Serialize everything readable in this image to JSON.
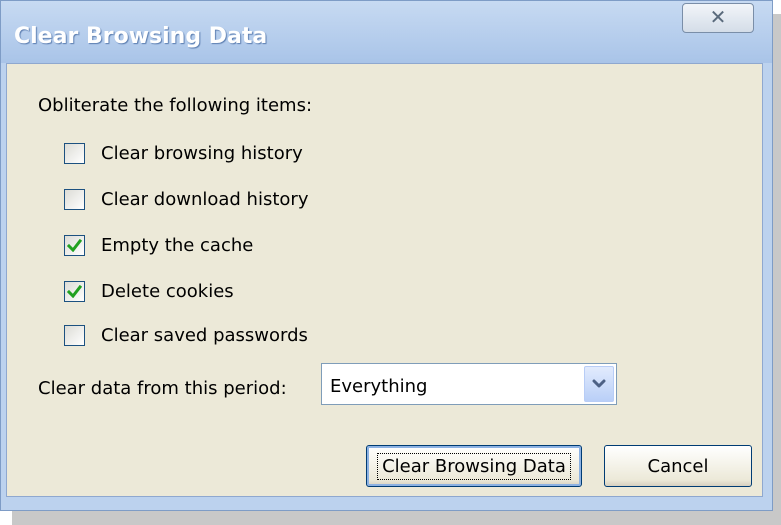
{
  "window": {
    "title": "Clear Browsing Data",
    "close_label": "✕"
  },
  "main": {
    "heading": "Obliterate the following items:",
    "checkboxes": [
      {
        "label": "Clear browsing history",
        "checked": false
      },
      {
        "label": "Clear download history",
        "checked": false
      },
      {
        "label": "Empty the cache",
        "checked": true
      },
      {
        "label": "Delete cookies",
        "checked": true
      },
      {
        "label": "Clear saved passwords",
        "checked": false
      }
    ],
    "period_label": "Clear data from this period:",
    "period_value": "Everything"
  },
  "buttons": {
    "primary_label": "Clear Browsing Data",
    "cancel_label": "Cancel"
  },
  "colors": {
    "check": "#21a121",
    "dropdown_arrow": "#4d6185"
  }
}
